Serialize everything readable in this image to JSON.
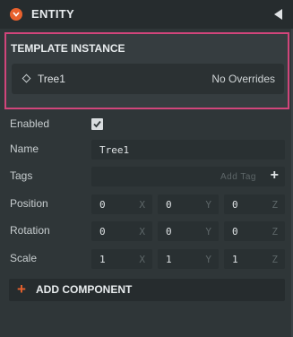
{
  "header": {
    "title": "ENTITY"
  },
  "template": {
    "label": "TEMPLATE INSTANCE",
    "name": "Tree1",
    "overrides": "No Overrides"
  },
  "fields": {
    "enabled_label": "Enabled",
    "enabled_value": true,
    "name_label": "Name",
    "name_value": "Tree1",
    "tags_label": "Tags",
    "tags_add": "Add Tag",
    "tags_plus": "+",
    "position_label": "Position",
    "position": [
      {
        "value": "0",
        "axis": "X"
      },
      {
        "value": "0",
        "axis": "Y"
      },
      {
        "value": "0",
        "axis": "Z"
      }
    ],
    "rotation_label": "Rotation",
    "rotation": [
      {
        "value": "0",
        "axis": "X"
      },
      {
        "value": "0",
        "axis": "Y"
      },
      {
        "value": "0",
        "axis": "Z"
      }
    ],
    "scale_label": "Scale",
    "scale": [
      {
        "value": "1",
        "axis": "X"
      },
      {
        "value": "1",
        "axis": "Y"
      },
      {
        "value": "1",
        "axis": "Z"
      }
    ]
  },
  "add_component": {
    "plus": "+",
    "label": "ADD COMPONENT"
  },
  "colors": {
    "accent": "#e8612d",
    "highlight": "#d1457b",
    "panel": "#2f3638"
  },
  "icons": {
    "header": "chevron-down-icon",
    "collapse": "triangle-left-icon",
    "template": "diamond-icon",
    "enabled": "checkmark-icon"
  }
}
